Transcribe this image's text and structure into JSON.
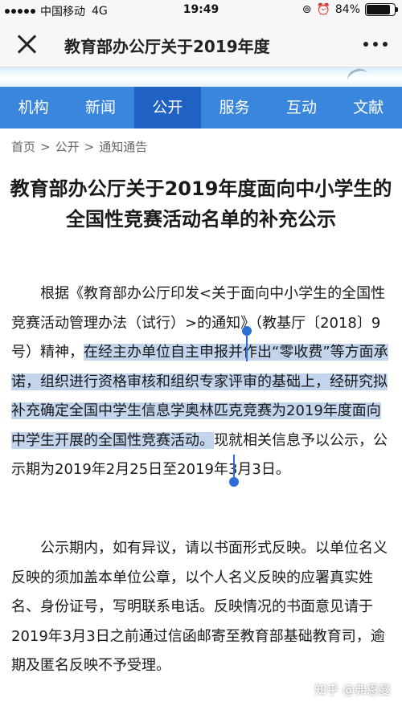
{
  "status_bar": {
    "carrier": "中国移动",
    "network": "4G",
    "time": "19:49",
    "battery": "84%",
    "battery_level": 0.84,
    "icons": [
      "signal-icon",
      "rotation-lock-icon",
      "alarm-icon",
      "battery-icon"
    ]
  },
  "navbar": {
    "title": "教育部办公厅关于2019年度"
  },
  "menu": {
    "items": [
      {
        "label": "机构"
      },
      {
        "label": "新闻"
      },
      {
        "label": "公开"
      },
      {
        "label": "服务"
      },
      {
        "label": "互动"
      },
      {
        "label": "文献"
      }
    ],
    "active_index": 2,
    "color": "#3a86dd",
    "active_color": "#1f62c4"
  },
  "breadcrumb": [
    "首页",
    "公开",
    "通知通告"
  ],
  "article": {
    "title": "教育部办公厅关于2019年度面向中小学生的全国性竞赛活动名单的补充公示",
    "p1_before": "根据《教育部办公厅印发<关于面向中小学生的全国性竞赛活动管理办法（试行）>的通知》（教基厅〔2018〕9号）精神，",
    "p1_selected": "在经主办单位自主申报并作出“零收费”等方面承诺，组织进行资格审核和组织专家评审的基础上，经研究拟补充确定全国中学生信息学奥林匹克竞赛为2019年度面向中学生开展的全国性竞赛活动。",
    "p1_after": "现就相关信息予以公示，公示期为2019年2月25日至2019年3月3日。",
    "p2": "公示期内，如有异议，请以书面形式反映。以单位名义反映的须加盖本单位公章，以个人名义反映的应署真实姓名、身份证号，写明联系电话。反映情况的书面意见请于2019年3月3日之前通过信函邮寄至教育部基础教育司，逾期及匿名反映不予受理。"
  },
  "watermark": "知乎 @弗恩曼",
  "selection_color": "#2c6ed5"
}
